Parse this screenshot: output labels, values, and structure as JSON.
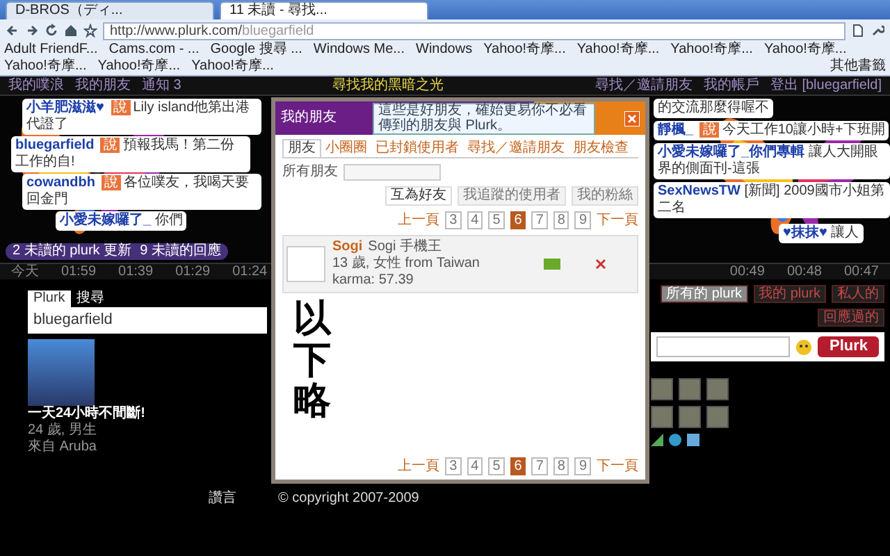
{
  "browser": {
    "tabs": [
      {
        "label": "D-BROS（ディ...",
        "selected": false
      },
      {
        "label": "11 未讀 - 尋找...",
        "selected": true
      }
    ],
    "url": {
      "host": "http://www.plurk.com/",
      "path": "bluegarfield"
    },
    "bookmarks": [
      "Adult FriendF...",
      "Cams.com - ...",
      "Google 搜尋 ...",
      "Windows Me...",
      "Windows",
      "Yahoo!奇摩...",
      "Yahoo!奇摩...",
      "Yahoo!奇摩...",
      "Yahoo!奇摩...",
      "Yahoo!奇摩...",
      "Yahoo!奇摩...",
      "Yahoo!奇摩..."
    ],
    "other_bookmarks": "其他書籤"
  },
  "plurk_bar": {
    "left": [
      "我的噗浪",
      "我的朋友",
      "通知 3"
    ],
    "title": "尋找我的黑暗之光",
    "right": [
      "尋找／邀請朋友",
      "我的帳戶",
      "登出 [bluegarfield]"
    ]
  },
  "timeline": {
    "bubbles": [
      {
        "user": "小羊肥滋滋♥",
        "qualifier": "說",
        "text": "Lily island他第出港代證了"
      },
      {
        "user": "bluegarfield",
        "qualifier": "說",
        "text": "預報我馬！第二份工作的自!"
      },
      {
        "user": "cowandbh",
        "qualifier": "說",
        "text": "各位噗友，我喝天要回金門"
      },
      {
        "user": "小愛未嫁囉了_",
        "text": "你們"
      },
      {
        "text": "的交流那麼得喔不"
      },
      {
        "user": "靜楓_",
        "qualifier": "說",
        "text": "今天工作10讓小時+下班開"
      },
      {
        "user": "小愛未嫁囉了_你們專輯",
        "text": "讓人大開眼界的側面刊-這張"
      },
      {
        "user": "SexNewsTW",
        "text": "[新聞] 2009國市小姐第二名"
      },
      {
        "user": "♥抹抹♥",
        "text": "讓人"
      }
    ],
    "unread": [
      "2 未讀的 plurk 更新",
      "9 未讀的回應"
    ],
    "times_left": [
      "今天",
      "01:59",
      "01:39",
      "01:29",
      "01:24"
    ],
    "times_right": [
      "00:49",
      "00:48",
      "00:47"
    ],
    "filters": [
      {
        "label": "所有的 plurk",
        "selected": true
      },
      {
        "label": "我的 plurk",
        "selected": false
      },
      {
        "label": "私人的",
        "selected": false
      },
      {
        "label": "回應過的",
        "selected": false
      }
    ]
  },
  "composer": {
    "tabs": [
      {
        "label": "Plurk",
        "selected": true
      },
      {
        "label": "搜尋",
        "selected": false
      }
    ],
    "user": "bluegarfield",
    "button": "Plurk"
  },
  "profile": {
    "name": "一天24小時不間斷!",
    "details": [
      "24 歲, 男生",
      "來自 Aruba"
    ]
  },
  "footer": {
    "left": "讚言",
    "copyright": "© copyright 2007-2009"
  },
  "dialog": {
    "title": "我的朋友",
    "tooltip": "這些是好朋友，確始更易你不必看傳到的朋友與 Plurk。",
    "tabs": [
      {
        "label": "朋友",
        "selected": true
      },
      {
        "label": "小圈圈",
        "selected": false
      },
      {
        "label": "已封鎖使用者",
        "selected": false
      },
      {
        "label": "尋找／邀請朋友",
        "selected": false
      },
      {
        "label": "朋友檢查",
        "selected": false
      }
    ],
    "filter_label": "所有朋友",
    "subtabs": [
      {
        "label": "互為好友",
        "selected": true
      },
      {
        "label": "我追蹤的使用者",
        "selected": false
      },
      {
        "label": "我的粉絲",
        "selected": false
      }
    ],
    "pagination_top": {
      "prev": "上一頁",
      "pages": [
        {
          "label": "3",
          "selected": false
        },
        {
          "label": "4",
          "selected": false
        },
        {
          "label": "5",
          "selected": false
        },
        {
          "label": "6",
          "selected": true
        },
        {
          "label": "7",
          "selected": false
        },
        {
          "label": "8",
          "selected": false
        },
        {
          "label": "9",
          "selected": false
        }
      ],
      "next": "下一頁"
    },
    "friends": [
      {
        "name": "Sogi",
        "display_name": "Sogi 手機王",
        "info": "13 歲, 女性 from Taiwan",
        "karma": "karma: 57.39"
      }
    ],
    "note": "以下略",
    "pagination_bottom": {
      "prev": "上一頁",
      "pages": [
        {
          "label": "3",
          "selected": false
        },
        {
          "label": "4",
          "selected": false
        },
        {
          "label": "5",
          "selected": false
        },
        {
          "label": "6",
          "selected": true
        },
        {
          "label": "7",
          "selected": false
        },
        {
          "label": "8",
          "selected": false
        },
        {
          "label": "9",
          "selected": false
        }
      ],
      "next": "下一頁"
    }
  }
}
